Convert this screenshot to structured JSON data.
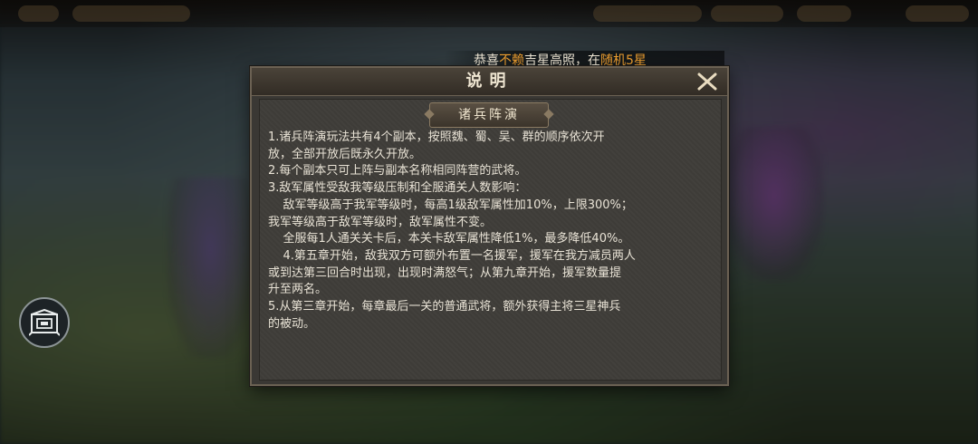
{
  "marquee": {
    "prefix": "恭喜",
    "player": "不赖",
    "middle": "吉星高照，在",
    "reward": "随机5星"
  },
  "dialog": {
    "title": "说明",
    "section_tag": "诸兵阵演",
    "lines": [
      "1.诸兵阵演玩法共有4个副本，按照魏、蜀、吴、群的顺序依次开",
      "放，全部开放后既永久开放。",
      "2.每个副本只可上阵与副本名称相同阵营的武将。",
      "3.敌军属性受敌我等级压制和全服通关人数影响：",
      "    敌军等级高于我军等级时，每高1级敌军属性加10%，上限300%；",
      "我军等级高于敌军等级时，敌军属性不变。",
      "    全服每1人通关关卡后，本关卡敌军属性降低1%，最多降低40%。",
      "    4.第五章开始，敌我双方可额外布置一名援军，援军在我方减员两人",
      "或到达第三回合时出现，出现时满怒气；从第九章开始，援军数量提",
      "升至两名。",
      "5.从第三章开始，每章最后一关的普通武将，额外获得主将三星神兵",
      "的被动。"
    ]
  },
  "icons": {
    "close": "close-x-icon",
    "side_button": "book-icon"
  }
}
